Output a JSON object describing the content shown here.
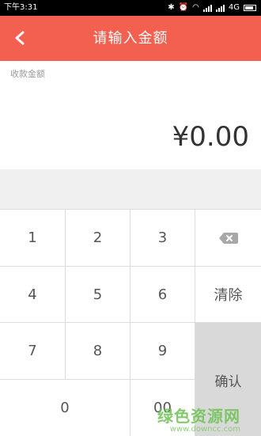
{
  "status_bar": {
    "time": "下午3:31",
    "network": "4G"
  },
  "header": {
    "title": "请输入金额",
    "back_icon": "chevron-left-icon"
  },
  "amount": {
    "label": "收款金额",
    "value": "¥0.00"
  },
  "keypad": {
    "keys": {
      "k1": "1",
      "k2": "2",
      "k3": "3",
      "k4": "4",
      "k5": "5",
      "k6": "6",
      "k7": "7",
      "k8": "8",
      "k9": "9",
      "k0": "0",
      "k00": "00"
    },
    "delete_icon": "backspace-icon",
    "clear_label": "清除",
    "confirm_label": "确认"
  },
  "watermark": {
    "text": "绿色资源网",
    "url": "www.downcc.com"
  },
  "colors": {
    "accent": "#f36050",
    "confirm_bg": "#d9d9d9"
  }
}
